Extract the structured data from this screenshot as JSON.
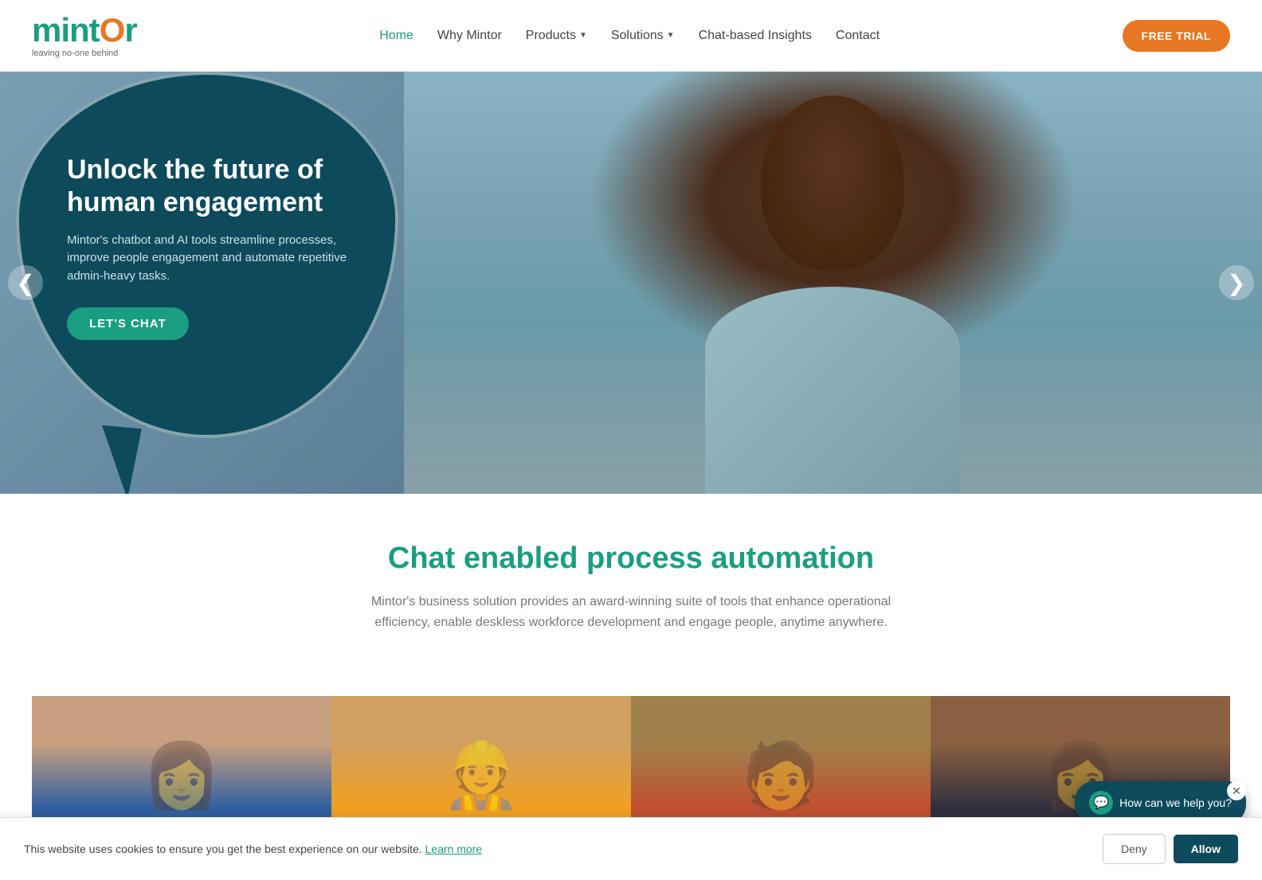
{
  "brand": {
    "name_part1": "mint",
    "name_letter": "O",
    "name_part2": "r",
    "tagline": "leaving no-one behind"
  },
  "navbar": {
    "links": [
      {
        "label": "Home",
        "active": true
      },
      {
        "label": "Why Mintor",
        "active": false
      },
      {
        "label": "Products",
        "active": false,
        "hasDropdown": true
      },
      {
        "label": "Solutions",
        "active": false,
        "hasDropdown": true
      },
      {
        "label": "Chat-based Insights",
        "active": false
      },
      {
        "label": "Contact",
        "active": false
      }
    ],
    "cta": "FREE TRIAL"
  },
  "hero": {
    "title": "Unlock the future of human engagement",
    "subtitle": "Mintor's chatbot and AI tools streamline processes, improve people engagement and automate repetitive admin-heavy tasks.",
    "cta": "LET'S CHAT",
    "prev_arrow": "❮",
    "next_arrow": "❯"
  },
  "main_section": {
    "title": "Chat enabled process automation",
    "description": "Mintor's business solution provides an award-winning suite of tools that enhance operational efficiency, enable deskless workforce development and engage people, anytime anywhere."
  },
  "cards": [
    {
      "id": 1
    },
    {
      "id": 2
    },
    {
      "id": 3
    },
    {
      "id": 4
    }
  ],
  "chat_widget": {
    "text": "How can we help you?",
    "close": "✕"
  },
  "cookie": {
    "message": "This website uses cookies to ensure you get the best experience on our website.",
    "learn_more": "Learn more",
    "deny": "Deny",
    "allow": "Allow"
  }
}
